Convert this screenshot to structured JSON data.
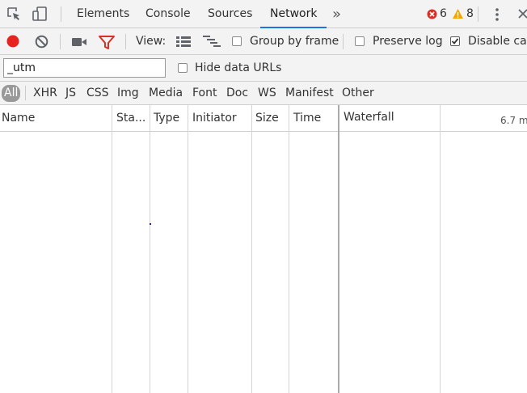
{
  "tabs": {
    "items": [
      {
        "label": "Elements"
      },
      {
        "label": "Console"
      },
      {
        "label": "Sources"
      },
      {
        "label": "Network",
        "active": true
      }
    ],
    "more": "»",
    "error_count": "6",
    "warning_count": "8"
  },
  "toolbar": {
    "view_label": "View:",
    "group_by_frame": {
      "label": "Group by frame",
      "checked": false
    },
    "preserve_log": {
      "label": "Preserve log",
      "checked": false
    },
    "disable_cache": {
      "label": "Disable cac",
      "checked": true
    }
  },
  "filter": {
    "value": "_utm",
    "hide_data_urls": {
      "label": "Hide data URLs",
      "checked": false
    }
  },
  "type_filters": [
    "All",
    "XHR",
    "JS",
    "CSS",
    "Img",
    "Media",
    "Font",
    "Doc",
    "WS",
    "Manifest",
    "Other"
  ],
  "columns": {
    "name": "Name",
    "status": "Sta...",
    "type": "Type",
    "initiator": "Initiator",
    "size": "Size",
    "time": "Time",
    "waterfall": "Waterfall",
    "waterfall_tick": "6.7 m"
  },
  "colors": {
    "record": "#e8231f",
    "filter_icon": "#d93025",
    "active_tab": "#1a73e8",
    "error": "#d93025",
    "warning": "#f2a600"
  }
}
